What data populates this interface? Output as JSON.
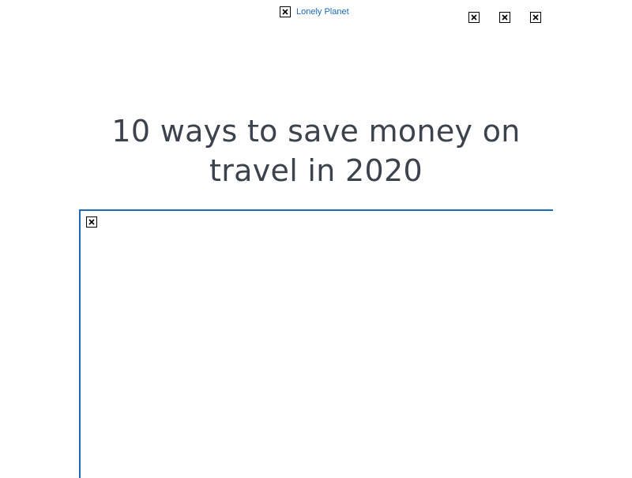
{
  "header": {
    "logo_alt": "Lonely Planet",
    "icons": [
      "broken-image-icon",
      "broken-image-icon",
      "broken-image-icon"
    ]
  },
  "article": {
    "title": "10 ways to save money on travel in 2020",
    "hero_image_icon": "broken-image-icon"
  },
  "colors": {
    "link": "#1a6bb5",
    "title": "#3d434d",
    "frame_border": "#1a6bb5"
  }
}
